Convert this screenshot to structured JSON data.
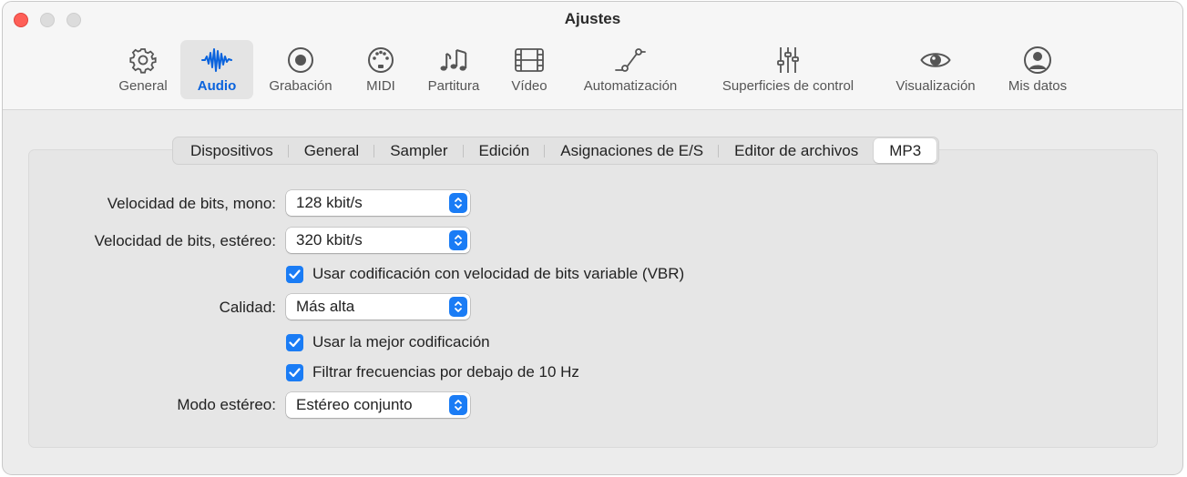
{
  "window": {
    "title": "Ajustes"
  },
  "toolbar": {
    "items": [
      {
        "label": "General",
        "icon": "gear-icon"
      },
      {
        "label": "Audio",
        "icon": "waveform-icon",
        "active": true
      },
      {
        "label": "Grabación",
        "icon": "record-icon"
      },
      {
        "label": "MIDI",
        "icon": "midi-port-icon"
      },
      {
        "label": "Partitura",
        "icon": "music-notes-icon"
      },
      {
        "label": "Vídeo",
        "icon": "film-icon"
      },
      {
        "label": "Automatización",
        "icon": "automation-curve-icon"
      },
      {
        "label": "Superficies de control",
        "icon": "faders-icon"
      },
      {
        "label": "Visualización",
        "icon": "eye-icon"
      },
      {
        "label": "Mis datos",
        "icon": "person-icon"
      }
    ]
  },
  "tabs": [
    "Dispositivos",
    "General",
    "Sampler",
    "Edición",
    "Asignaciones de E/S",
    "Editor de archivos",
    "MP3"
  ],
  "selected_tab": "MP3",
  "form": {
    "bitrate_mono": {
      "label": "Velocidad de bits, mono:",
      "value": "128 kbit/s"
    },
    "bitrate_stereo": {
      "label": "Velocidad de bits, estéreo:",
      "value": "320 kbit/s"
    },
    "vbr": {
      "label": "Usar codificación con velocidad de bits variable (VBR)",
      "checked": true
    },
    "quality": {
      "label": "Calidad:",
      "value": "Más alta"
    },
    "best_encoding": {
      "label": "Usar la mejor codificación",
      "checked": true
    },
    "filter": {
      "label": "Filtrar frecuencias por debajo de 10 Hz",
      "checked": true
    },
    "stereo_mode": {
      "label": "Modo estéreo:",
      "value": "Estéreo conjunto"
    }
  },
  "colors": {
    "accent": "#1a7cf5",
    "active_label": "#0a63dd",
    "close": "#fe5f57"
  }
}
